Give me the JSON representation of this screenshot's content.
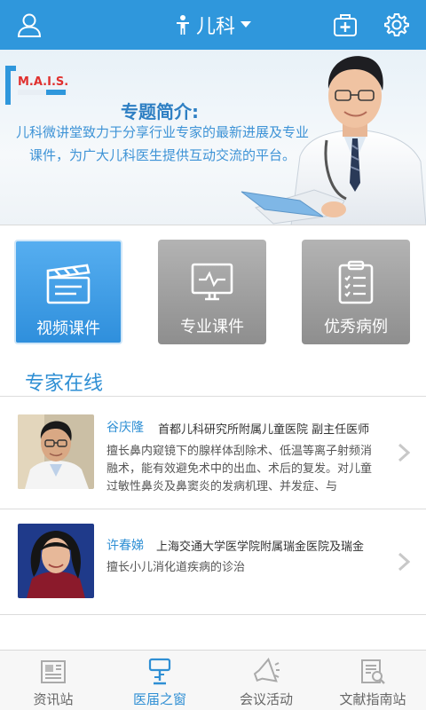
{
  "header": {
    "title": "儿科",
    "icons": {
      "profile": "user-icon",
      "title": "child-icon",
      "dropdown": "triangle-down-icon",
      "kit": "medical-kit-icon",
      "settings": "gear-icon"
    }
  },
  "banner": {
    "logo_text": "M.A.I.S.",
    "intro_title": "专题简介:",
    "intro_text": "儿科微讲堂致力于分享行业专家的最新进展及专业课件，为广大儿科医生提供互动交流的平台。"
  },
  "categories": [
    {
      "label": "视频课件",
      "icon": "video-clapper-icon",
      "selected": true
    },
    {
      "label": "专业课件",
      "icon": "monitor-icon",
      "selected": false
    },
    {
      "label": "优秀病例",
      "icon": "clipboard-icon",
      "selected": false
    }
  ],
  "experts_section": {
    "title": "专家在线",
    "items": [
      {
        "name": "谷庆隆",
        "org": "首都儿科研究所附属儿童医院 副主任医师",
        "desc": "擅长鼻内窥镜下的腺样体刮除术、低温等离子射频消融术，能有效避免术中的出血、术后的复发。对儿童过敏性鼻炎及鼻窦炎的发病机理、并发症、与"
      },
      {
        "name": "许春娣",
        "org": "上海交通大学医学院附属瑞金医院及瑞金",
        "desc": "擅长小儿消化道疾病的诊治"
      }
    ]
  },
  "bottom_nav": [
    {
      "label": "资讯站",
      "icon": "newspaper-icon",
      "active": false
    },
    {
      "label": "医届之窗",
      "icon": "lamp-icon",
      "active": true
    },
    {
      "label": "会议活动",
      "icon": "megaphone-icon",
      "active": false
    },
    {
      "label": "文献指南站",
      "icon": "document-search-icon",
      "active": false
    }
  ],
  "colors": {
    "primary": "#2f97dc",
    "accent_text": "#2f8fd4",
    "tile_inactive": "#9e9e9e"
  }
}
